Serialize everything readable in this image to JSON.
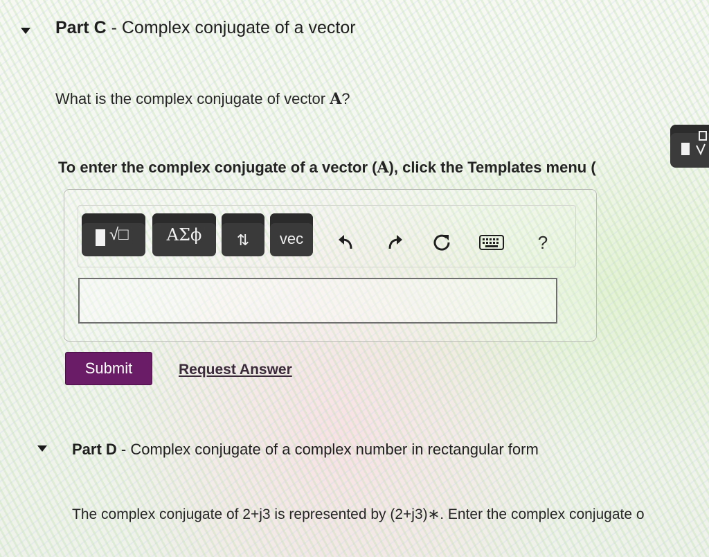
{
  "part_c": {
    "label": "Part C",
    "separator": "-",
    "title": "Complex conjugate of a vector",
    "question_prefix": "What is the complex conjugate of vector",
    "question_symbol": "A",
    "question_suffix": "?",
    "instruction_prefix": "To enter the complex conjugate of a vector (",
    "instruction_symbol": "A",
    "instruction_suffix": "), click the Templates menu ("
  },
  "toolbar": {
    "templates_label": "√□",
    "greek_label": "ΑΣϕ",
    "arrows_label": "⇅",
    "vec_label": "vec",
    "help_label": "?"
  },
  "answer": {
    "value": "",
    "placeholder": ""
  },
  "actions": {
    "submit_label": "Submit",
    "request_answer_label": "Request Answer"
  },
  "part_d": {
    "label": "Part D",
    "separator": "-",
    "title": "Complex conjugate of a complex number in rectangular form",
    "description": "The complex conjugate of 2+j3 is represented by (2+j3)∗. Enter the complex conjugate o"
  },
  "colors": {
    "submit_bg": "#6b1c66",
    "toolbar_button": "#3a3a3a"
  },
  "icons": {
    "collapse": "caret-down-icon",
    "undo": "undo-icon",
    "redo": "redo-icon",
    "reset": "reset-icon",
    "keyboard": "keyboard-icon"
  }
}
